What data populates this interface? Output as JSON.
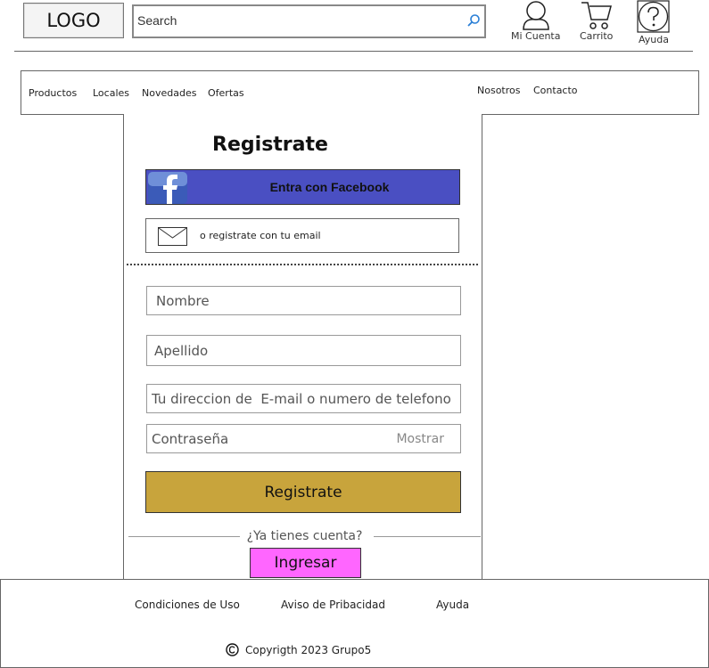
{
  "header": {
    "logo": "LOGO",
    "search_placeholder": "Search",
    "account_label": "Mi Cuenta",
    "cart_label": "Carrito",
    "help_label": "Ayuda"
  },
  "nav": {
    "left": [
      "Productos",
      "Locales",
      "Novedades",
      "Ofertas"
    ],
    "right": [
      "Nosotros",
      "Contacto"
    ]
  },
  "form": {
    "title": "Registrate",
    "facebook_label": "Entra con Facebook",
    "email_option_label": "o registrate con tu email",
    "name_placeholder": "Nombre",
    "lastname_placeholder": "Apellido",
    "contact_placeholder": "Tu direccion de  E-mail o numero de telefono",
    "password_placeholder": "Contraseña",
    "show_password_label": "Mostrar",
    "submit_label": "Registrate",
    "have_account_text": "¿Ya tienes cuenta?",
    "login_label": "Ingresar"
  },
  "colors": {
    "facebook": "#4a4fc2",
    "submit": "#c8a43c",
    "login": "#ff66ff"
  },
  "footer": {
    "links": [
      "Condiciones  de Uso",
      "Aviso de Pribacidad",
      "Ayuda"
    ],
    "copyright": "Copyrigth 2023 Grupo5"
  }
}
